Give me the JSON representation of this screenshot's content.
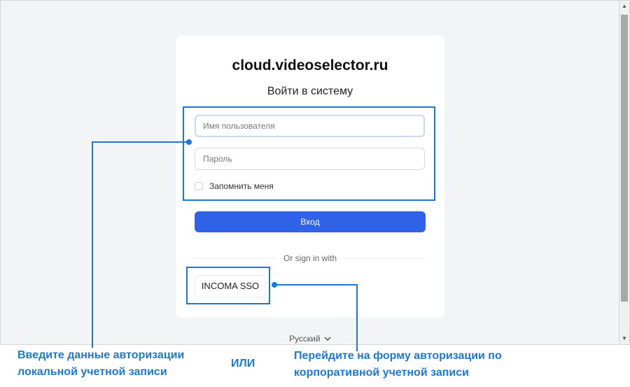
{
  "card": {
    "site_title": "cloud.videoselector.ru",
    "heading": "Войти в систему",
    "username_placeholder": "Имя пользователя",
    "password_placeholder": "Пароль",
    "remember_label": "Запомнить меня",
    "login_label": "Вход",
    "divider_text": "Or sign in with",
    "sso_label": "INCOMA SSO"
  },
  "language": {
    "selected": "Русский",
    "icon": "chevron-down-icon"
  },
  "annotations": {
    "local_line1": "Введите данные авторизации",
    "local_line2": "локальной учетной записи",
    "or_text": "ИЛИ",
    "sso_line1": "Перейдите на форму авторизации по",
    "sso_line2": "корпоративной учетной записи"
  },
  "colors": {
    "accent": "#2f62e6",
    "annotation": "#1c78d4",
    "background": "#f3f4f6"
  }
}
